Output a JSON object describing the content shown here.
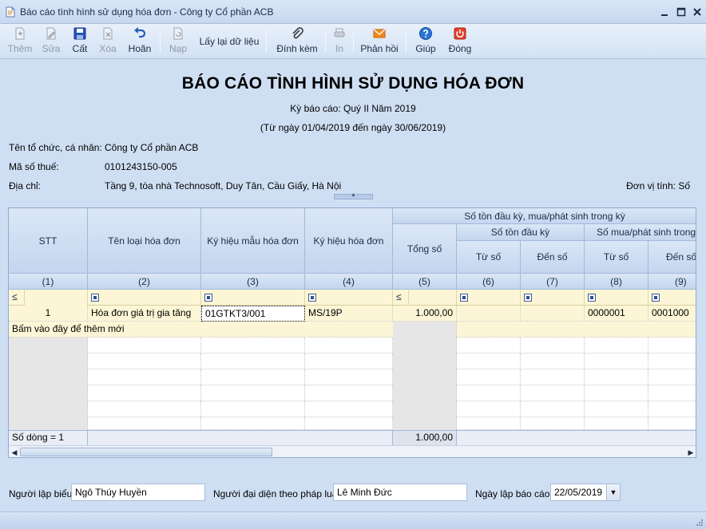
{
  "window": {
    "title": "Báo cáo tình hình sử dụng hóa đơn - Công ty Cổ phần ACB"
  },
  "toolbar": {
    "items": [
      {
        "id": "them",
        "label": "Thêm",
        "icon": "add-document-icon",
        "enabled": false
      },
      {
        "id": "sua",
        "label": "Sửa",
        "icon": "edit-document-icon",
        "enabled": false
      },
      {
        "id": "cat",
        "label": "Cất",
        "icon": "save-disk-icon",
        "enabled": true
      },
      {
        "id": "xoa",
        "label": "Xóa",
        "icon": "delete-document-icon",
        "enabled": false
      },
      {
        "id": "hoan",
        "label": "Hoãn",
        "icon": "undo-arrow-icon",
        "enabled": true
      },
      {
        "id": "nap",
        "label": "Nạp",
        "icon": "reload-document-icon",
        "enabled": false
      },
      {
        "id": "laylai",
        "label": "Lấy lại dữ liệu",
        "icon": "",
        "enabled": true
      },
      {
        "id": "dinhkem",
        "label": "Đính kèm",
        "icon": "paperclip-icon",
        "enabled": true
      },
      {
        "id": "in",
        "label": "In",
        "icon": "printer-icon",
        "enabled": false
      },
      {
        "id": "phanhoi",
        "label": "Phản hồi",
        "icon": "envelope-icon",
        "enabled": true
      },
      {
        "id": "giup",
        "label": "Giúp",
        "icon": "help-icon",
        "enabled": true
      },
      {
        "id": "dong",
        "label": "Đóng",
        "icon": "power-close-icon",
        "enabled": true
      }
    ]
  },
  "report": {
    "title": "BÁO CÁO TÌNH HÌNH SỬ DỤNG HÓA ĐƠN",
    "period": "Kỳ báo cáo: Quý II Năm 2019",
    "range": "(Từ ngày 01/04/2019 đến ngày 30/06/2019)",
    "org_label": "Tên tổ chức, cá nhân:",
    "org_value": "Công ty Cổ phần ACB",
    "tax_label": "Mã số thuế:",
    "tax_value": "0101243150-005",
    "addr_label": "Địa chỉ:",
    "addr_value": "Tầng 9, tòa nhà Technosoft, Duy Tân, Cầu Giấy, Hà Nội",
    "unit": "Đơn vị tính: Số"
  },
  "grid": {
    "headers": {
      "stt": "STT",
      "ten_loai": "Tên loại hóa đơn",
      "ky_hieu_mau": "Ký hiệu mẫu hóa đơn",
      "ky_hieu": "Ký hiệu hóa đơn",
      "group_ton": "Số tồn đầu kỳ, mua/phát sinh trong kỳ",
      "tong_so": "Tổng số",
      "ton_dau_ky": "Số tồn đầu kỳ",
      "mua_trong_ky": "Số mua/phát sinh trong kỳ",
      "tu_so_1": "Từ số",
      "den_so_1": "Đến số",
      "tu_so_2": "Từ số",
      "den_so_2": "Đến số"
    },
    "col_numbers": [
      "(1)",
      "(2)",
      "(3)",
      "(4)",
      "(5)",
      "(6)",
      "(7)",
      "(8)",
      "(9)"
    ],
    "filter_symbols": {
      "c1": "≤",
      "c5": "≤"
    },
    "rows": [
      {
        "stt": "1",
        "ten_loai": "Hóa đơn giá trị gia tăng",
        "ky_hieu_mau": "01GTKT3/001",
        "ky_hieu": "MS/19P",
        "tong_so": "1.000,00",
        "tu_so_1": "",
        "den_so_1": "",
        "tu_so_2": "0000001",
        "den_so_2": "0001000"
      }
    ],
    "new_row_hint": "Bấm vào đây để thêm mới",
    "footer_count": "Số dòng = 1",
    "footer_total": "1.000,00"
  },
  "form": {
    "creator_label": "Người lập biểu",
    "creator_value": "Ngô Thúy Huyền",
    "rep_label": "Người đại diện theo pháp luật",
    "rep_value": "Lê Minh Đức",
    "date_label": "Ngày lập báo cáo:",
    "date_value": "22/05/2019"
  }
}
